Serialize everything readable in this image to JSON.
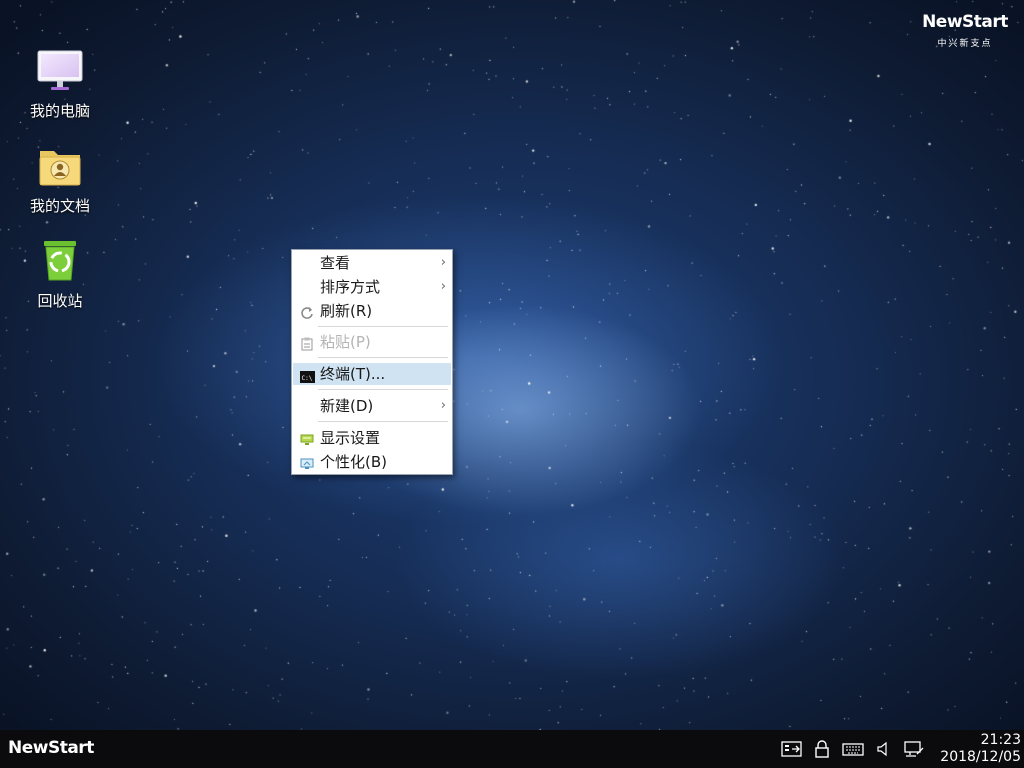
{
  "desktop_icons": [
    {
      "label": "我的电脑",
      "icon": "computer-icon"
    },
    {
      "label": "我的文档",
      "icon": "documents-folder-icon"
    },
    {
      "label": "回收站",
      "icon": "recycle-bin-icon"
    }
  ],
  "brand": {
    "wordmark": "NewStart",
    "subtitle": "中兴新支点"
  },
  "context_menu": {
    "items": [
      {
        "label": "查看",
        "icon": null,
        "submenu": true,
        "enabled": true
      },
      {
        "label": "排序方式",
        "icon": null,
        "submenu": true,
        "enabled": true
      },
      {
        "label": "刷新(R)",
        "icon": "refresh-icon",
        "submenu": false,
        "enabled": true
      },
      {
        "label": "粘贴(P)",
        "icon": "paste-icon",
        "submenu": false,
        "enabled": false
      },
      {
        "label": "终端(T)...",
        "icon": "terminal-icon",
        "submenu": false,
        "enabled": true,
        "highlighted": true
      },
      {
        "label": "新建(D)",
        "icon": null,
        "submenu": true,
        "enabled": true
      },
      {
        "label": "显示设置",
        "icon": "display-settings-icon",
        "submenu": false,
        "enabled": true
      },
      {
        "label": "个性化(B)",
        "icon": "personalize-icon",
        "submenu": false,
        "enabled": true
      }
    ],
    "submenu_arrow": "›"
  },
  "taskbar": {
    "start_label": "NewStart",
    "tray_icons": [
      "show-desktop-icon",
      "lock-icon",
      "keyboard-icon",
      "volume-icon",
      "network-icon"
    ],
    "clock": {
      "time": "21:23",
      "date": "2018/12/05"
    }
  },
  "colors": {
    "menu_highlight": "#cfe3f3",
    "taskbar": "#0b0b0d"
  }
}
